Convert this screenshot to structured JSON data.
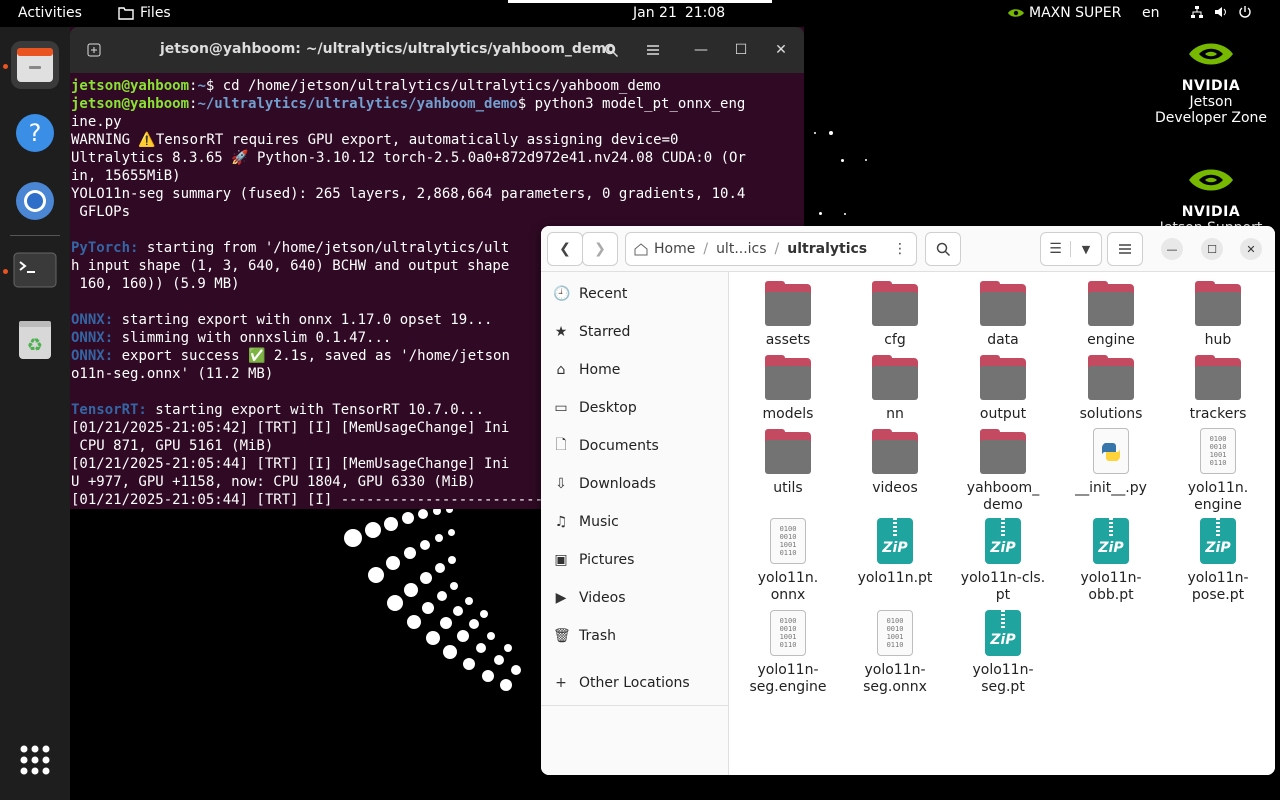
{
  "topbar": {
    "activities": "Activities",
    "app_name": "Files",
    "date": "Jan 21",
    "time": "21:08",
    "power_mode": "MAXN SUPER",
    "language": "en"
  },
  "desktop": {
    "icons": [
      {
        "brand": "NVIDIA",
        "label": "Jetson Developer Zone"
      },
      {
        "brand": "NVIDIA",
        "label": "Jetson Support"
      }
    ]
  },
  "terminal": {
    "title": "jetson@yahboom: ~/ultralytics/ultralytics/yahboom_demo",
    "lines": [
      {
        "user": "jetson@yahboom",
        "sep": ":",
        "path": "~",
        "rest": "$ cd /home/jetson/ultralytics/ultralytics/yahboom_demo"
      },
      {
        "user": "jetson@yahboom",
        "sep": ":",
        "path": "~/ultralytics/ultralytics/yahboom_demo",
        "rest": "$ python3 model_pt_onnx_eng"
      },
      {
        "text": "ine.py"
      },
      {
        "text": "WARNING ⚠️TensorRT requires GPU export, automatically assigning device=0"
      },
      {
        "text": "Ultralytics 8.3.65 🚀 Python-3.10.12 torch-2.5.0a0+872d972e41.nv24.08 CUDA:0 (Or"
      },
      {
        "text": "in, 15655MiB)"
      },
      {
        "text": "YOLO11n-seg summary (fused): 265 layers, 2,868,664 parameters, 0 gradients, 10.4"
      },
      {
        "text": " GFLOPs"
      },
      {
        "text": ""
      },
      {
        "tag": "PyTorch:",
        "text": " starting from '/home/jetson/ultralytics/ult"
      },
      {
        "text": "h input shape (1, 3, 640, 640) BCHW and output shape"
      },
      {
        "text": " 160, 160)) (5.9 MB)"
      },
      {
        "text": ""
      },
      {
        "tag": "ONNX:",
        "text": " starting export with onnx 1.17.0 opset 19..."
      },
      {
        "tag": "ONNX:",
        "text": " slimming with onnxslim 0.1.47..."
      },
      {
        "tag": "ONNX:",
        "text": " export success ✅ 2.1s, saved as '/home/jetson"
      },
      {
        "text": "o11n-seg.onnx' (11.2 MB)"
      },
      {
        "text": ""
      },
      {
        "tag": "TensorRT:",
        "text": " starting export with TensorRT 10.7.0..."
      },
      {
        "text": "[01/21/2025-21:05:42] [TRT] [I] [MemUsageChange] Ini"
      },
      {
        "text": " CPU 871, GPU 5161 (MiB)"
      },
      {
        "text": "[01/21/2025-21:05:44] [TRT] [I] [MemUsageChange] Ini"
      },
      {
        "text": "U +977, GPU +1158, now: CPU 1804, GPU 6330 (MiB)"
      },
      {
        "text": "[01/21/2025-21:05:44] [TRT] [I] ------------------------"
      }
    ]
  },
  "files": {
    "path": {
      "home": "Home",
      "middle": "ult...ics",
      "current": "ultralytics"
    },
    "sidebar": [
      {
        "label": "Recent",
        "icon": "clock-icon",
        "glyph": "🕘"
      },
      {
        "label": "Starred",
        "icon": "star-icon",
        "glyph": "★"
      },
      {
        "label": "Home",
        "icon": "home-icon",
        "glyph": "⌂"
      },
      {
        "label": "Desktop",
        "icon": "desktop-icon",
        "glyph": "▭"
      },
      {
        "label": "Documents",
        "icon": "documents-icon",
        "glyph": "🗋"
      },
      {
        "label": "Downloads",
        "icon": "download-icon",
        "glyph": "⇩"
      },
      {
        "label": "Music",
        "icon": "music-icon",
        "glyph": "♫"
      },
      {
        "label": "Pictures",
        "icon": "pictures-icon",
        "glyph": "▣"
      },
      {
        "label": "Videos",
        "icon": "videos-icon",
        "glyph": "▶"
      },
      {
        "label": "Trash",
        "icon": "trash-icon",
        "glyph": "🗑"
      },
      {
        "label": "Other Locations",
        "icon": "plus-icon",
        "glyph": "+"
      }
    ],
    "items": [
      {
        "name": "assets",
        "type": "folder"
      },
      {
        "name": "cfg",
        "type": "folder"
      },
      {
        "name": "data",
        "type": "folder"
      },
      {
        "name": "engine",
        "type": "folder"
      },
      {
        "name": "hub",
        "type": "folder"
      },
      {
        "name": "models",
        "type": "folder"
      },
      {
        "name": "nn",
        "type": "folder"
      },
      {
        "name": "output",
        "type": "folder"
      },
      {
        "name": "solutions",
        "type": "folder"
      },
      {
        "name": "trackers",
        "type": "folder"
      },
      {
        "name": "utils",
        "type": "folder"
      },
      {
        "name": "videos",
        "type": "folder"
      },
      {
        "name": "yahboom_\ndemo",
        "type": "folder"
      },
      {
        "name": "__init__.py",
        "type": "python"
      },
      {
        "name": "yolo11n.\nengine",
        "type": "binary"
      },
      {
        "name": "yolo11n.\nonnx",
        "type": "binary"
      },
      {
        "name": "yolo11n.pt",
        "type": "zip"
      },
      {
        "name": "yolo11n-cls.\npt",
        "type": "zip"
      },
      {
        "name": "yolo11n-\nobb.pt",
        "type": "zip"
      },
      {
        "name": "yolo11n-\npose.pt",
        "type": "zip"
      },
      {
        "name": "yolo11n-\nseg.engine",
        "type": "binary"
      },
      {
        "name": "yolo11n-\nseg.onnx",
        "type": "binary"
      },
      {
        "name": "yolo11n-\nseg.pt",
        "type": "zip"
      }
    ]
  },
  "colors": {
    "terminal_bg": "#300a24",
    "folder_accent": "#c34a61",
    "zip_teal": "#20a4a0",
    "nvidia_green": "#76b900",
    "ubuntu_orange": "#e95420"
  }
}
